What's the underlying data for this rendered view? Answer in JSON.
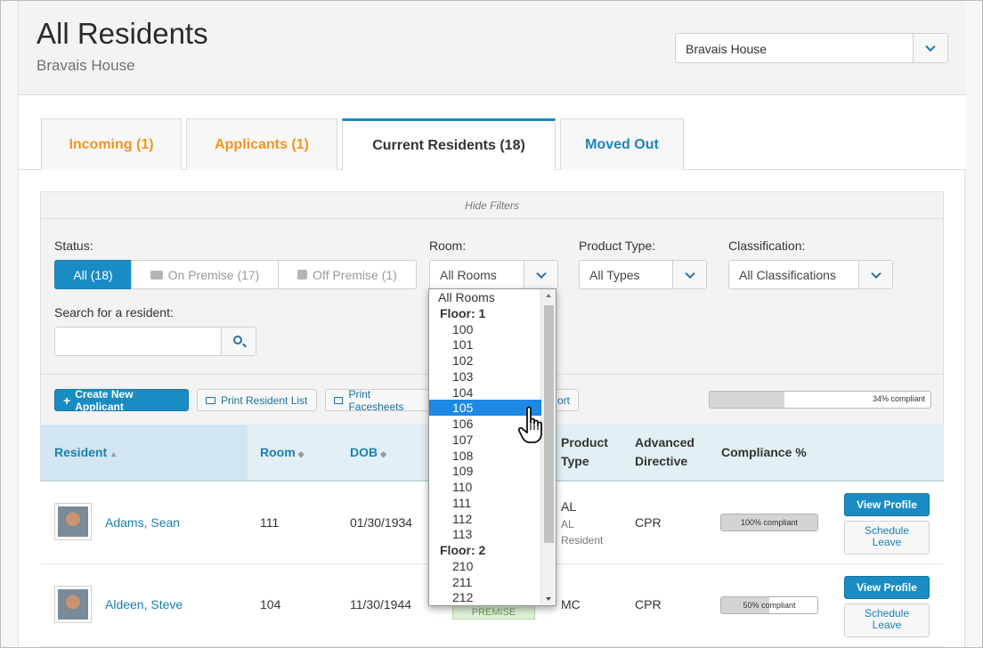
{
  "header": {
    "title": "All Residents",
    "subtitle": "Bravais House",
    "facility_value": "Bravais House"
  },
  "tabs": [
    {
      "label": "Incoming  (1)"
    },
    {
      "label": "Applicants  (1)"
    },
    {
      "label": "Current Residents  (18)"
    },
    {
      "label": "Moved Out"
    }
  ],
  "filters": {
    "hide_label": "Hide Filters",
    "status_label": "Status:",
    "status_options": [
      {
        "label": "All (18)",
        "icon": ""
      },
      {
        "label": "On Premise (17)",
        "icon": "bed-icon"
      },
      {
        "label": "Off Premise (1)",
        "icon": "suitcase-icon"
      }
    ],
    "room_label": "Room:",
    "room_value": "All Rooms",
    "product_label": "Product Type:",
    "product_value": "All Types",
    "class_label": "Classification:",
    "class_value": "All Classifications",
    "search_label": "Search for a resident:",
    "search_value": ""
  },
  "actions": {
    "create": "Create New Applicant",
    "print_list": "Print Resident List",
    "print_face": "Print Facesheets",
    "report_tail": "ort",
    "overall_compliance_label": "34% compliant",
    "overall_compliance": 0.34
  },
  "table": {
    "headers": {
      "resident": "Resident",
      "room": "Room",
      "dob": "DOB",
      "product1": "Product",
      "product2": "Type",
      "directive1": "Advanced",
      "directive2": "Directive",
      "compliance": "Compliance %"
    },
    "rows": [
      {
        "name": "Adams, Sean",
        "room": "111",
        "dob": "01/30/1934",
        "product": "AL",
        "product_sub1": "AL",
        "product_sub2": "Resident",
        "directive": "CPR",
        "compliance_label": "100% compliant",
        "compliance": 1.0,
        "view": "View Profile",
        "schedule1": "Schedule",
        "schedule2": "Leave"
      },
      {
        "name": "Aldeen, Steve",
        "room": "104",
        "dob": "11/30/1944",
        "status_badge": "PREMISE",
        "product": "MC",
        "directive": "CPR",
        "compliance_label": "50% compliant",
        "compliance": 0.5,
        "view": "View Profile",
        "schedule1": "Schedule",
        "schedule2": "Leave"
      }
    ]
  },
  "room_dropdown": {
    "items": [
      {
        "label": "All Rooms",
        "kind": "first"
      },
      {
        "label": "Floor: 1",
        "kind": "group"
      },
      {
        "label": "100",
        "kind": "opt"
      },
      {
        "label": "101",
        "kind": "opt"
      },
      {
        "label": "102",
        "kind": "opt"
      },
      {
        "label": "103",
        "kind": "opt"
      },
      {
        "label": "104",
        "kind": "opt"
      },
      {
        "label": "105",
        "kind": "opt",
        "selected": true
      },
      {
        "label": "106",
        "kind": "opt"
      },
      {
        "label": "107",
        "kind": "opt"
      },
      {
        "label": "108",
        "kind": "opt"
      },
      {
        "label": "109",
        "kind": "opt"
      },
      {
        "label": "110",
        "kind": "opt"
      },
      {
        "label": "111",
        "kind": "opt"
      },
      {
        "label": "112",
        "kind": "opt"
      },
      {
        "label": "113",
        "kind": "opt"
      },
      {
        "label": "Floor: 2",
        "kind": "group"
      },
      {
        "label": "210",
        "kind": "opt"
      },
      {
        "label": "211",
        "kind": "opt"
      },
      {
        "label": "212",
        "kind": "opt"
      }
    ]
  },
  "colors": {
    "accent": "#1a8cc4",
    "orange": "#f0961f",
    "selection": "#1e88e5"
  }
}
